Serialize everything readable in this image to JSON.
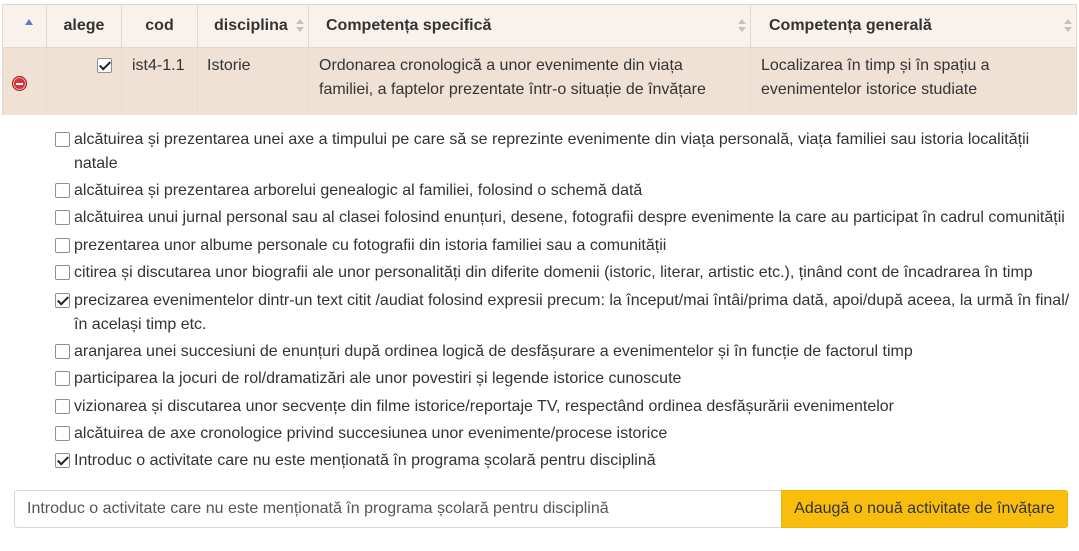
{
  "table": {
    "headers": {
      "alege": "alege",
      "cod": "cod",
      "disciplina": "disciplina",
      "competenta_specifica": "Competența specifică",
      "competenta_generala": "Competența generală"
    },
    "row": {
      "checked": true,
      "cod": "ist4-1.1",
      "disciplina": "Istorie",
      "competenta_specifica": "Ordonarea cronologică a unor evenimente din viața familiei, a faptelor prezentate într-o situație de învățare",
      "competenta_generala": "Localizarea în timp și în spațiu a evenimentelor istorice studiate"
    }
  },
  "activities": [
    {
      "text": "alcătuirea și prezentarea unei axe a timpului pe care să se reprezinte evenimente din viața personală, viața familiei sau istoria localității natale",
      "checked": false
    },
    {
      "text": "alcătuirea și prezentarea arborelui genealogic al familiei, folosind o schemă dată",
      "checked": false
    },
    {
      "text": "alcătuirea unui jurnal personal sau al clasei folosind enunțuri, desene, fotografii despre evenimente la care au participat în cadrul comunității",
      "checked": false
    },
    {
      "text": "prezentarea unor albume personale cu fotografii din istoria familiei sau a comunității",
      "checked": false
    },
    {
      "text": "citirea și discutarea unor biografii ale unor personalități din diferite domenii (istoric, literar, artistic etc.), ținând cont de încadrarea în timp",
      "checked": false
    },
    {
      "text": "precizarea evenimentelor dintr-un text citit /audiat folosind expresii precum: la început/mai întâi/prima dată, apoi/după aceea, la urmă în final/în același timp etc.",
      "checked": true
    },
    {
      "text": "aranjarea unei succesiuni de enunțuri după ordinea logică de desfășurare a evenimentelor și în funcție de factorul timp",
      "checked": false
    },
    {
      "text": "participarea la jocuri de rol/dramatizări ale unor povestiri și legende istorice cunoscute",
      "checked": false
    },
    {
      "text": "vizionarea și discutarea unor secvențe din filme istorice/reportaje TV, respectând ordinea desfășurării evenimentelor",
      "checked": false
    },
    {
      "text": "alcătuirea de axe cronologice privind succesiunea unor evenimente/procese istorice",
      "checked": false
    },
    {
      "text": "Introduc o activitate care nu este menționată în programa școlară pentru disciplină",
      "checked": true
    }
  ],
  "add_activity": {
    "input_value": "Introduc o activitate care nu este menționată în programa școlară pentru disciplină",
    "button_label": "Adaugă o nouă activitate de învățare"
  },
  "colors": {
    "header_bg": "#f9f2ec",
    "row_bg": "#efe2d5",
    "button_bg": "#f8bd0d",
    "remove_icon": "#d9343a",
    "sort_active": "#5b7ec7"
  }
}
